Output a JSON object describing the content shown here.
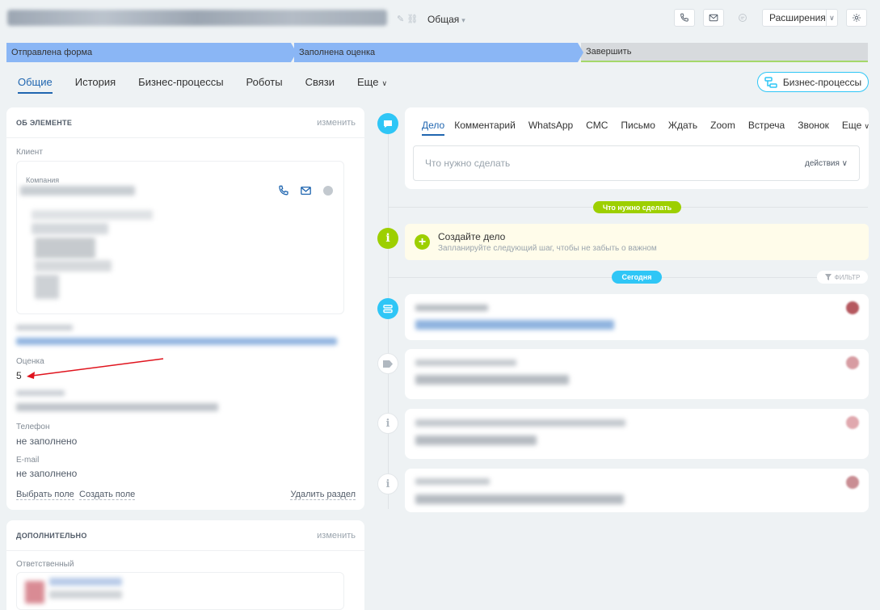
{
  "header": {
    "category": "Общая",
    "extensions_label": "Расширения"
  },
  "stages": [
    {
      "label": "Отправлена форма"
    },
    {
      "label": "Заполнена оценка"
    },
    {
      "label": "Завершить"
    }
  ],
  "tabs": [
    {
      "label": "Общие"
    },
    {
      "label": "История"
    },
    {
      "label": "Бизнес-процессы"
    },
    {
      "label": "Роботы"
    },
    {
      "label": "Связи"
    },
    {
      "label": "Еще"
    }
  ],
  "bp_button": "Бизнес-процессы",
  "about": {
    "title": "ОБ ЭЛЕМЕНТЕ",
    "edit": "изменить",
    "client_label": "Клиент",
    "company_label": "Компания",
    "rating_label": "Оценка",
    "rating_value": "5",
    "phone_label": "Телефон",
    "phone_value": "не заполнено",
    "email_label": "E-mail",
    "email_value": "не заполнено",
    "choose_field": "Выбрать поле",
    "create_field": "Создать поле",
    "delete_section": "Удалить раздел"
  },
  "additional": {
    "title": "ДОПОЛНИТЕЛЬНО",
    "edit": "изменить",
    "responsible_label": "Ответственный"
  },
  "editor": {
    "tabs": [
      "Дело",
      "Комментарий",
      "WhatsApp",
      "СМС",
      "Письмо",
      "Ждать",
      "Zoom",
      "Встреча",
      "Звонок",
      "Еще"
    ],
    "placeholder": "Что нужно сделать",
    "actions": "действия"
  },
  "timeline": {
    "todo_pill": "Что нужно сделать",
    "todo_title": "Создайте дело",
    "todo_sub": "Запланируйте следующий шаг, чтобы не забыть о важном",
    "today_pill": "Сегодня",
    "filter": "ФИЛЬТР"
  },
  "colors": {
    "stage_done": "#8ab6f5",
    "accent": "#2066b0",
    "green": "#9dcf00",
    "cyan": "#2fc6f6"
  }
}
